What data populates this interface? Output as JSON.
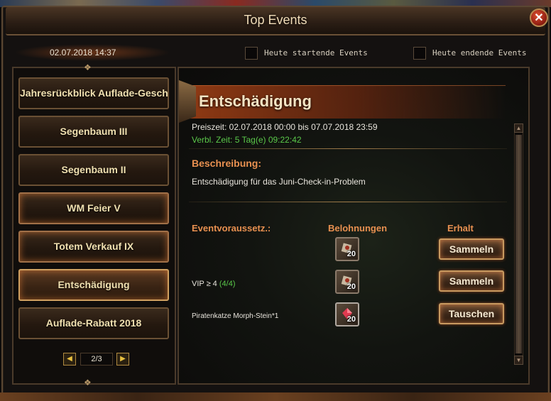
{
  "window": {
    "title": "Top Events",
    "close_glyph": "✕"
  },
  "datetime": "02.07.2018 14:37",
  "filters": {
    "today_start_label": "Heute startende Events",
    "today_end_label": "Heute endende Events"
  },
  "sidebar": {
    "items": [
      {
        "label": "Jahresrückblick Auflade-Geschenke"
      },
      {
        "label": "Segenbaum III"
      },
      {
        "label": "Segenbaum II"
      },
      {
        "label": "WM Feier V"
      },
      {
        "label": "Totem Verkauf IX"
      },
      {
        "label": "Entschädigung"
      },
      {
        "label": "Auflade-Rabatt 2018"
      }
    ],
    "pager": {
      "page": "2/3",
      "prev_glyph": "◀",
      "next_glyph": "▶"
    }
  },
  "event": {
    "title": "Entschädigung",
    "period": "Preiszeit: 02.07.2018 00:00 bis 07.07.2018 23:59",
    "remaining": "Verbl. Zeit: 5 Tag(e)  09:22:42",
    "desc_heading": "Beschreibung:",
    "description": "Entschädigung für das Juni-Check-in-Problem",
    "columns": {
      "condition": "Eventvoraussetz.:",
      "rewards": "Belohnungen",
      "receive": "Erhalt"
    },
    "rows": [
      {
        "condition": "",
        "condition_progress": "",
        "item_icon": "scroll-item-icon",
        "quantity": "20",
        "button": "Sammeln"
      },
      {
        "condition": "VIP ≥ 4 ",
        "condition_progress": "(4/4)",
        "item_icon": "scroll-item-icon",
        "quantity": "20",
        "button": "Sammeln"
      },
      {
        "condition": "Piratenkatze Morph-Stein*1",
        "condition_progress": "",
        "item_icon": "red-gem-item-icon",
        "quantity": "20",
        "button": "Tauschen"
      }
    ]
  },
  "colors": {
    "accent_orange": "#e89050",
    "progress_green": "#5ac84a",
    "title_gold": "#f0dcb8"
  }
}
